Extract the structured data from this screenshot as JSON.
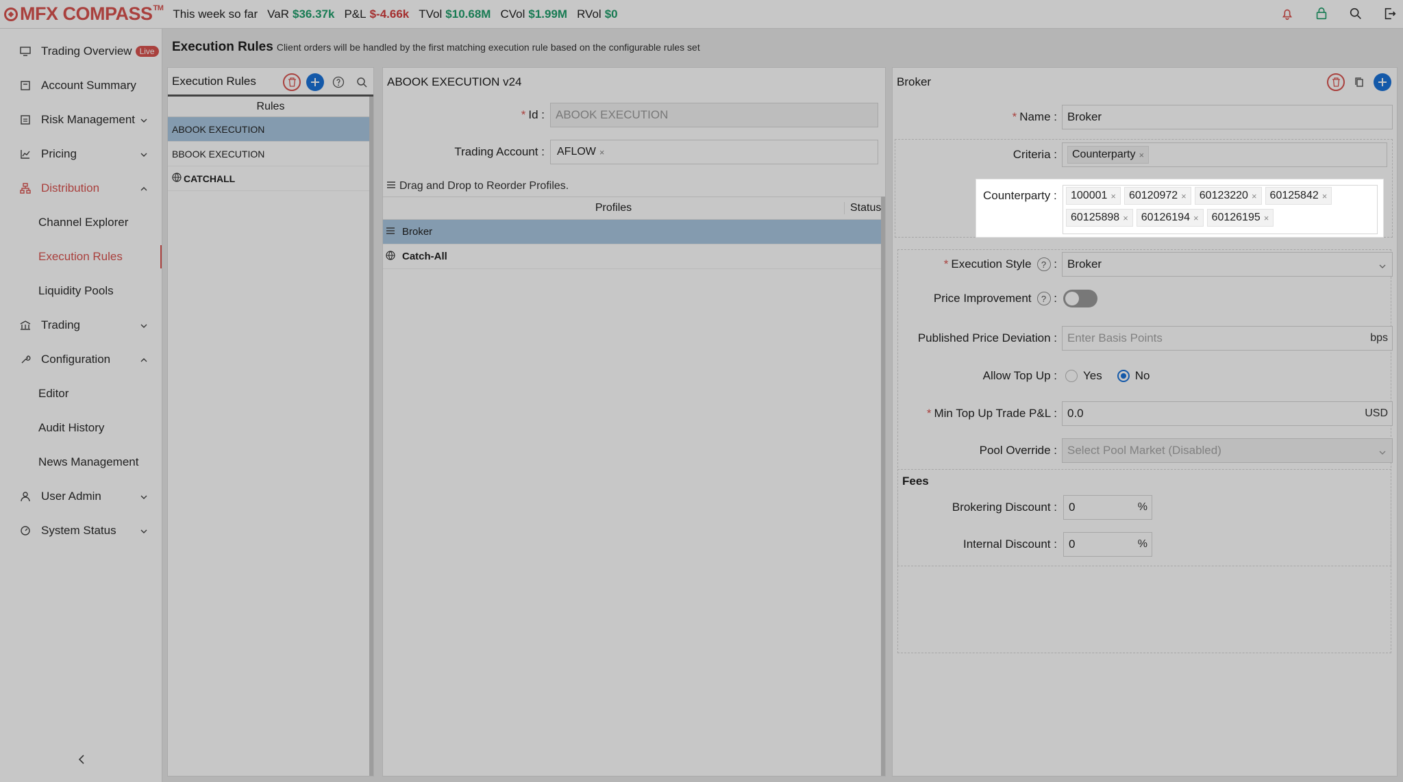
{
  "topbar": {
    "logo": "MFX COMPASS",
    "tm": "TM",
    "period": "This week so far",
    "metrics": [
      {
        "label": "VaR",
        "value": "$36.37k",
        "tone": "pos"
      },
      {
        "label": "P&L",
        "value": "$-4.66k",
        "tone": "neg"
      },
      {
        "label": "TVol",
        "value": "$10.68M",
        "tone": "pos"
      },
      {
        "label": "CVol",
        "value": "$1.99M",
        "tone": "pos"
      },
      {
        "label": "RVol",
        "value": "$0",
        "tone": "pos"
      }
    ],
    "icons": [
      "bell-icon",
      "lock-icon",
      "search-icon",
      "logout-icon"
    ]
  },
  "sidebar": {
    "items": [
      {
        "label": "Trading Overview",
        "badge": "Live",
        "icon": "monitor-icon"
      },
      {
        "label": "Account Summary",
        "icon": "calendar-icon"
      },
      {
        "label": "Risk Management",
        "icon": "sheet-icon"
      },
      {
        "label": "Pricing",
        "icon": "chart-icon"
      },
      {
        "label": "Distribution",
        "icon": "sitemap-icon"
      },
      {
        "label": "Channel Explorer"
      },
      {
        "label": "Execution Rules"
      },
      {
        "label": "Liquidity Pools"
      },
      {
        "label": "Trading",
        "icon": "bank-icon"
      },
      {
        "label": "Configuration",
        "icon": "wrench-icon"
      },
      {
        "label": "Editor"
      },
      {
        "label": "Audit History"
      },
      {
        "label": "News Management"
      },
      {
        "label": "User Admin",
        "icon": "user-icon"
      },
      {
        "label": "System Status",
        "icon": "dashboard-icon"
      }
    ]
  },
  "main": {
    "title": "Execution Rules",
    "description": "Client orders will be handled by the first matching execution rule based on the configurable rules set"
  },
  "rules_panel": {
    "title": "Execution Rules",
    "column": "Rules",
    "rows": [
      "ABOOK EXECUTION",
      "BBOOK EXECUTION",
      "CATCHALL"
    ]
  },
  "profile_panel": {
    "title": "ABOOK EXECUTION v24",
    "id_label": "Id",
    "id_value": "ABOOK EXECUTION",
    "account_label": "Trading Account",
    "account_tag": "AFLOW",
    "drag_note": "Drag and Drop to Reorder Profiles.",
    "col_profiles": "Profiles",
    "col_status": "Status",
    "profiles": [
      "Broker",
      "Catch-All"
    ]
  },
  "broker_panel": {
    "title": "Broker",
    "name_label": "Name",
    "name_value": "Broker",
    "criteria_label": "Criteria",
    "criteria_tag": "Counterparty",
    "counterparty_label": "Counterparty",
    "counterparties": [
      "100001",
      "60120972",
      "60123220",
      "60125842",
      "60125898",
      "60126194",
      "60126195"
    ],
    "exec_style_label": "Execution Style",
    "exec_style_value": "Broker",
    "price_improvement_label": "Price Improvement",
    "ppd_label": "Published Price Deviation",
    "ppd_placeholder": "Enter Basis Points",
    "ppd_suffix": "bps",
    "topup_label": "Allow Top Up",
    "topup_yes": "Yes",
    "topup_no": "No",
    "min_topup_label": "Min Top Up Trade P&L",
    "min_topup_value": "0.0",
    "min_topup_suffix": "USD",
    "pool_label": "Pool Override",
    "pool_placeholder": "Select Pool Market (Disabled)",
    "fees_title": "Fees",
    "brokering_label": "Brokering Discount",
    "brokering_value": "0",
    "internal_label": "Internal Discount",
    "internal_value": "0",
    "pct": "%"
  },
  "colors": {
    "accent": "#d9534f",
    "blue": "#1a73d9",
    "positive": "#1f9e6b",
    "negative": "#d23c3c",
    "selected_row": "#a9c7e0"
  }
}
